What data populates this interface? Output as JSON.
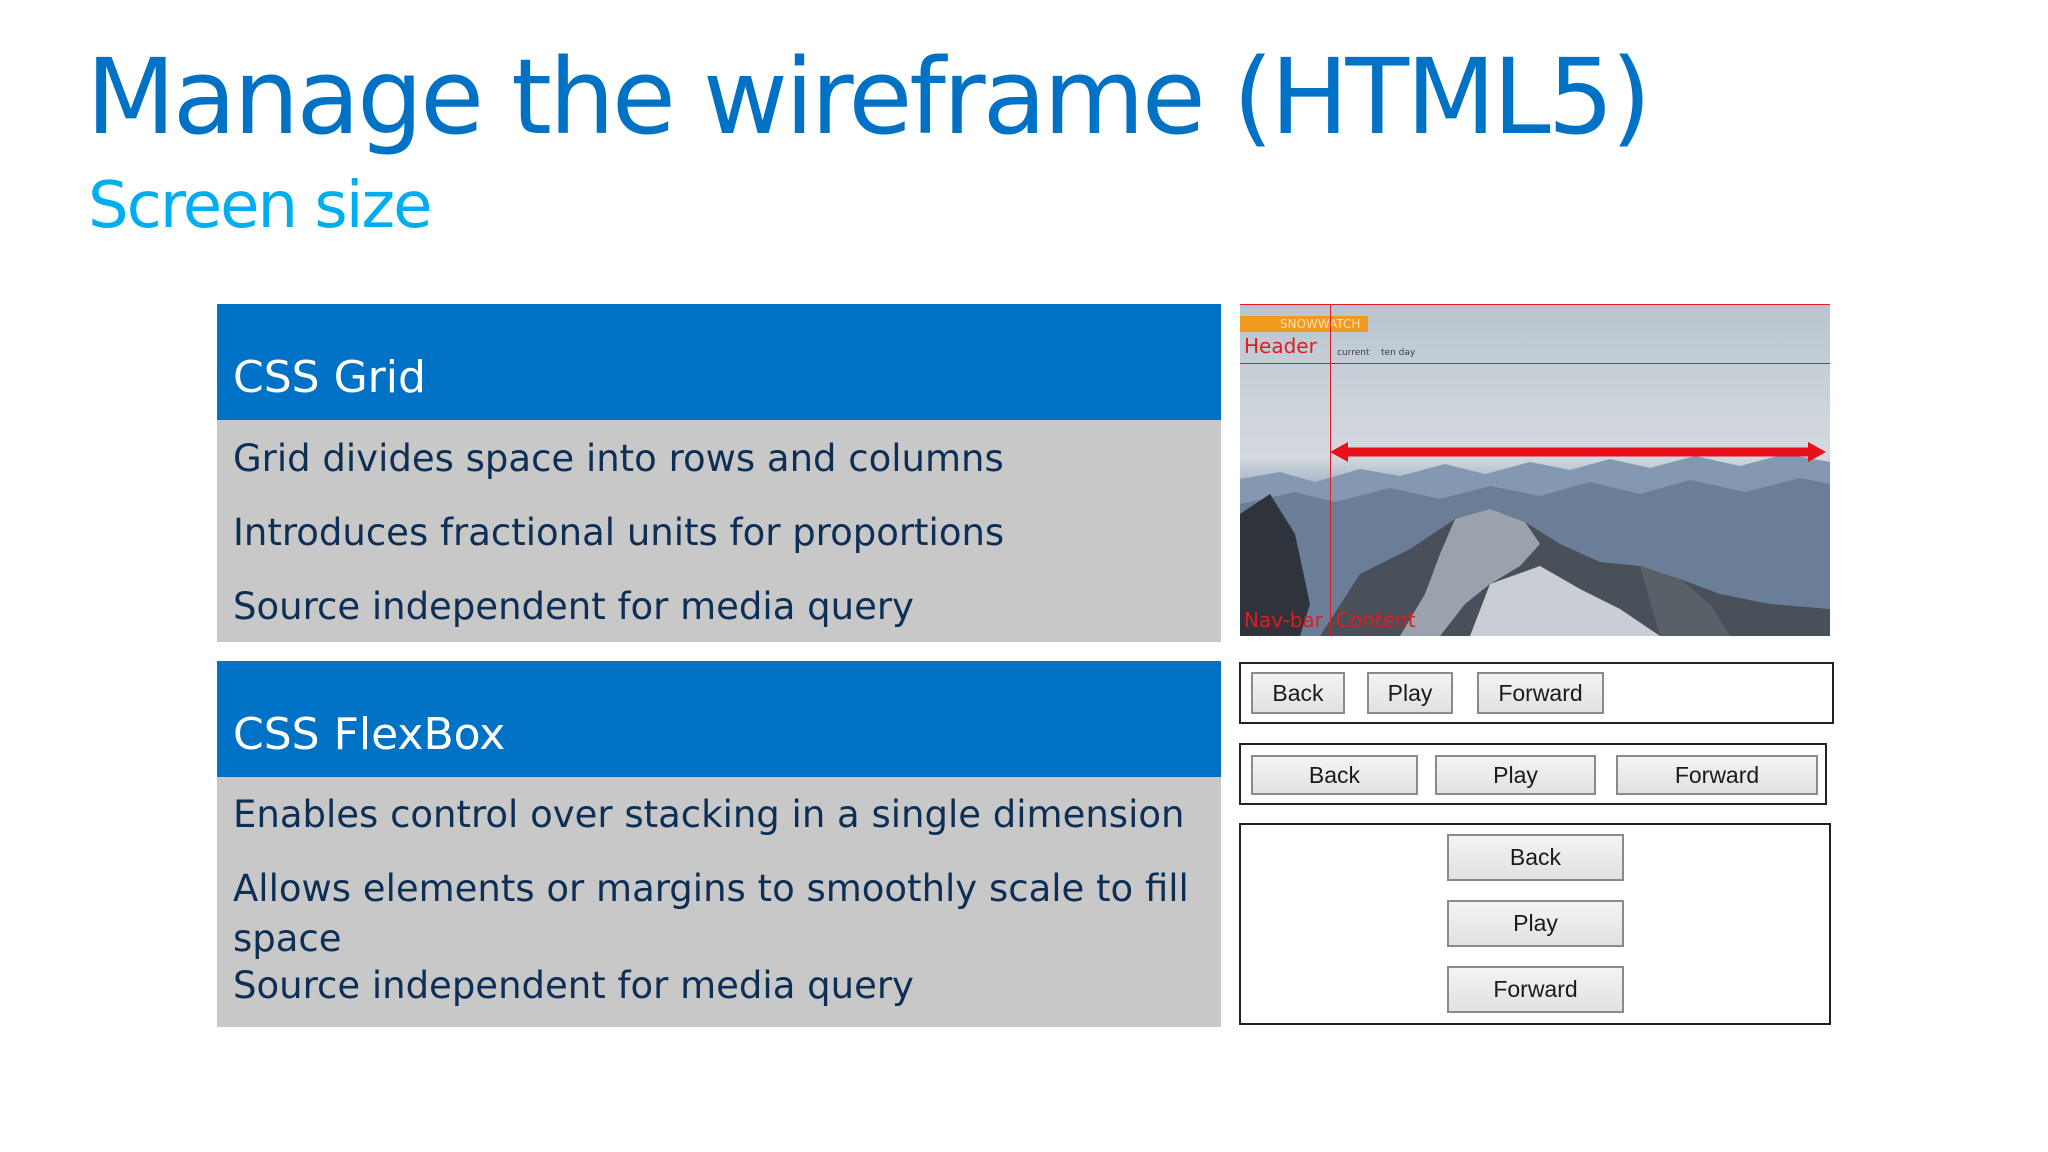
{
  "slide": {
    "title": "Manage the wireframe (HTML5)",
    "subtitle": "Screen size"
  },
  "grid_panel": {
    "heading": "CSS Grid",
    "bullets": [
      "Grid divides space into rows and columns",
      "Introduces fractional units for proportions",
      "Source independent for media query"
    ]
  },
  "flexbox_panel": {
    "heading": "CSS FlexBox",
    "bullets": [
      "Enables control over stacking in a single dimension",
      "Allows elements or margins to smoothly scale to fill space",
      "Source independent for media query"
    ]
  },
  "grid_illustration": {
    "logo": "SNOWWATCH",
    "header_label": "Header",
    "navbar_label": "Nav-bar",
    "content_label": "Content",
    "tabs": [
      "current",
      "ten day"
    ]
  },
  "flex_demos": {
    "row_compact": {
      "back": "Back",
      "play": "Play",
      "forward": "Forward"
    },
    "row_stretched": {
      "back": "Back",
      "play": "Play",
      "forward": "Forward"
    },
    "column": {
      "back": "Back",
      "play": "Play",
      "forward": "Forward"
    }
  },
  "colors": {
    "title_blue": "#0072c6",
    "subtitle_cyan": "#00aeef",
    "panel_header_blue": "#0072c6",
    "panel_body_gray": "#c8c8c8",
    "bullet_text_navy": "#0d2e55",
    "grid_line_red": "#e01b22",
    "logo_orange": "#f29a1e"
  }
}
